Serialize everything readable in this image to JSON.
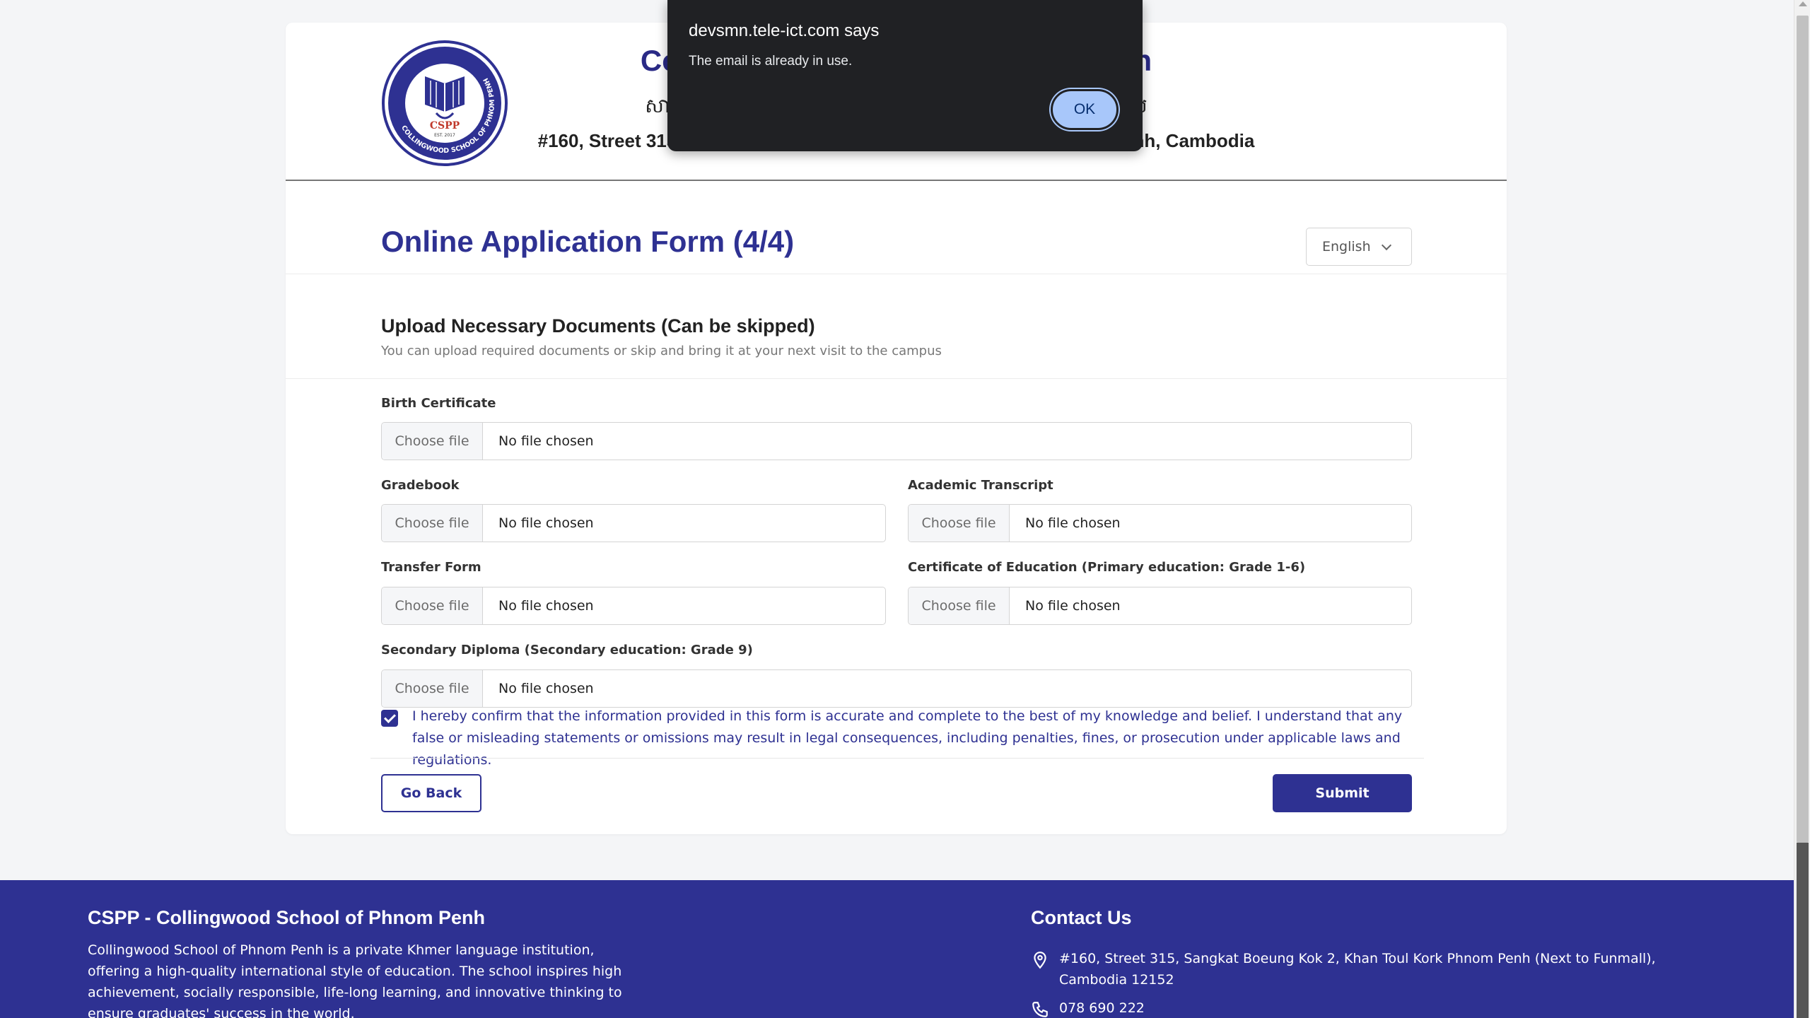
{
  "header": {
    "school_name": "Collingwood School of Phnom Penh",
    "school_khmer": "សាលារៀន កូលីងវូដ ភ្នំពេញ ផ្ដល់ការអប់រំទូទៅភាសាខ្មែរ និងអង់គ្លេស",
    "address": "#160, Street 315, Sangkat Boeung Kok 2, Khan Toul Kork, Phnom Penh, Cambodia",
    "logo_text": "CSPP",
    "logo_ring_text": "COLLINGWOOD SCHOOL OF PHNOM PENH",
    "logo_est": "EST. 2017"
  },
  "form": {
    "title": "Online Application Form (4/4)",
    "language": "English",
    "section_title": "Upload Necessary Documents (Can be skipped)",
    "section_subtitle": "You can upload required documents or skip and bring it at your next visit to the campus",
    "choose_label": "Choose file",
    "no_file_label": "No file chosen",
    "fields": {
      "birth_certificate": "Birth Certificate",
      "gradebook": "Gradebook",
      "academic_transcript": "Academic Transcript",
      "transfer_form": "Transfer Form",
      "certificate_education": "Certificate of Education (Primary education: Grade 1-6)",
      "secondary_diploma": "Secondary Diploma (Secondary education: Grade 9)"
    },
    "confirm_text": "I hereby confirm that the information provided in this form is accurate and complete to the best of my knowledge and belief. I understand that any false or misleading statements or omissions may result in legal consequences, including penalties, fines, or prosecution under applicable laws and regulations.",
    "confirm_checked": true,
    "back_label": "Go Back",
    "submit_label": "Submit"
  },
  "alert": {
    "title": "devsmn.tele-ict.com says",
    "message": "The email is already in use.",
    "ok_label": "OK"
  },
  "footer": {
    "title": "CSPP - Collingwood School of Phnom Penh",
    "description": "Collingwood School of Phnom Penh is a private Khmer language institution, offering a high-quality international style of education. The school inspires high achievement, socially responsible, life-long learning, and innovative thinking to ensure graduates' success in the world.",
    "contact_title": "Contact Us",
    "address": "#160, Street 315, Sangkat Boeung Kok 2, Khan Toul Kork Phnom Penh (Next to Funmall), Cambodia 12152",
    "phone": "078 690 222"
  },
  "colors": {
    "brand": "#2e3192",
    "alert_bg": "#202124",
    "alert_button": "#a8c7fa"
  }
}
